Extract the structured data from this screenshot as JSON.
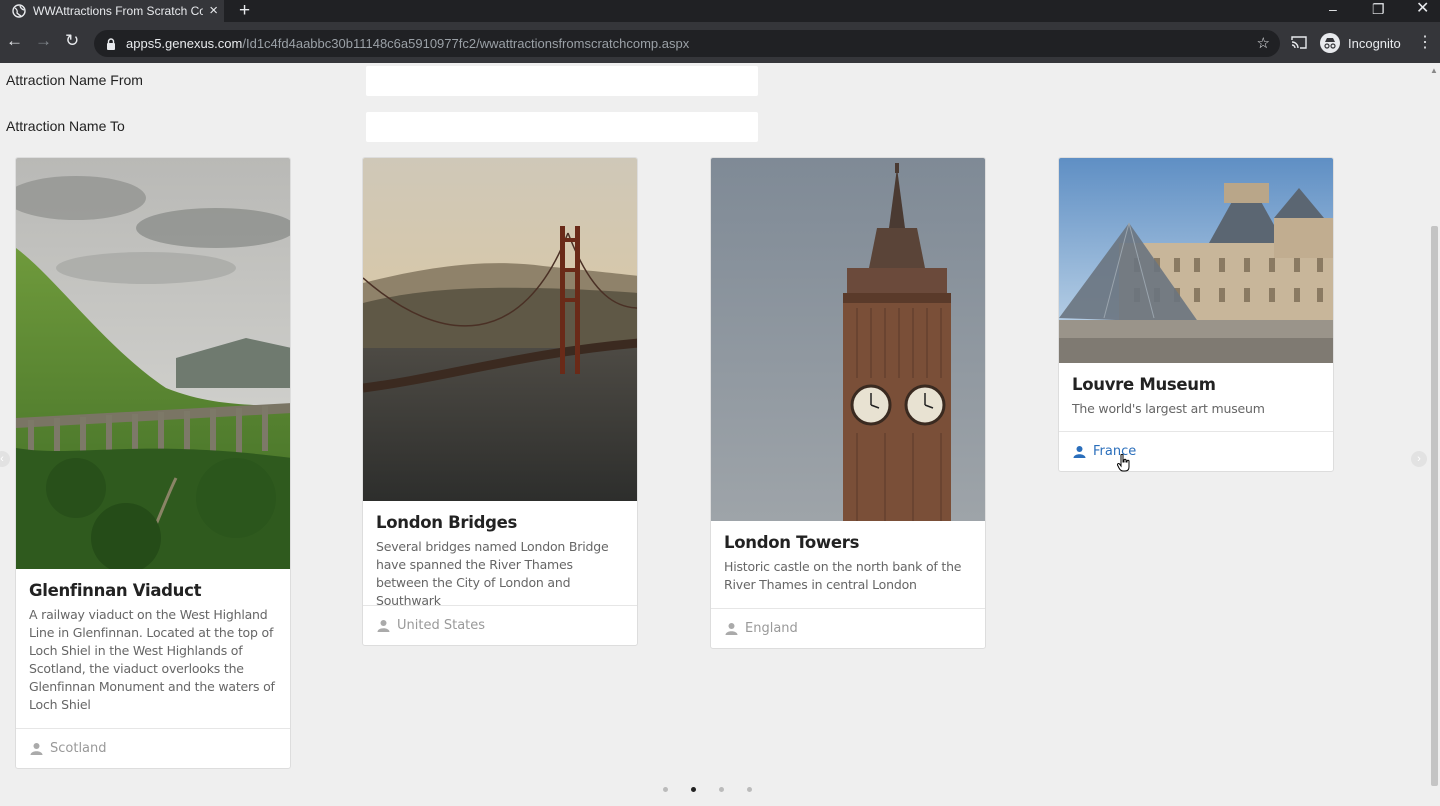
{
  "browser": {
    "tab_title": "WWAttractions From Scratch Com",
    "new_tab": "+",
    "url_host": "apps5.genexus.com",
    "url_path": "/Id1c4fd4aabbc30b11148c6a5910977fc2/wwattractionsfromscratchcomp.aspx",
    "profile_label": "Incognito"
  },
  "filters": {
    "name_from_label": "Attraction Name From",
    "name_from_value": "",
    "name_to_label": "Attraction Name To",
    "name_to_value": ""
  },
  "cards": [
    {
      "title": "Glenfinnan Viaduct",
      "description": "A railway viaduct on the West Highland Line in Glenfinnan. Located at the top of Loch Shiel in the West Highlands of Scotland, the viaduct overlooks the Glenfinnan Monument and the waters of Loch Shiel",
      "country": "Scotland",
      "image": "viaduct-photo"
    },
    {
      "title": "London Bridges",
      "description": "Several bridges named London Bridge have spanned the River Thames between the City of London and Southwark",
      "country": "United States",
      "image": "golden-gate-bridge-photo"
    },
    {
      "title": "London Towers",
      "description": "Historic castle on the north bank of the River Thames in central London",
      "country": "England",
      "image": "big-ben-photo"
    },
    {
      "title": "Louvre Museum",
      "description": "The world's largest art museum",
      "country": "France",
      "image": "louvre-photo"
    }
  ],
  "carousel": {
    "pages": 4,
    "active_page": 2
  },
  "colors": {
    "link": "#2a6ebb",
    "chrome_dark": "#35363a",
    "page_bg": "#efefef"
  }
}
